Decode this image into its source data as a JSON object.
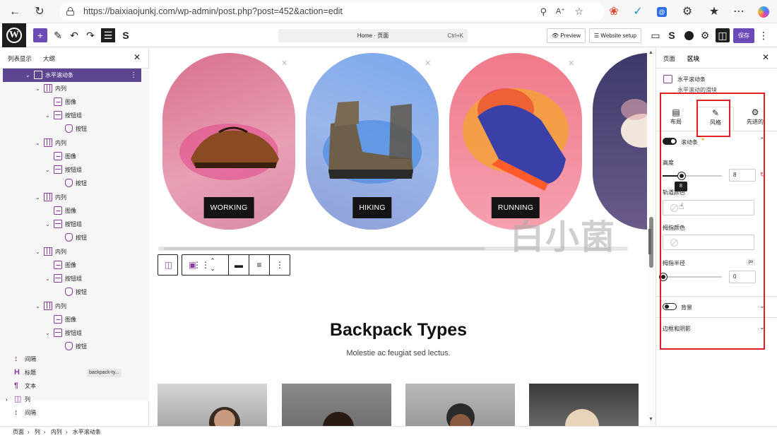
{
  "browser": {
    "url": "https://baixiaojunkj.com/wp-admin/post.php?post=452&action=edit"
  },
  "editor": {
    "document_title": "Home · 页面",
    "shortcut": "Ctrl+K",
    "preview_label": "Preview",
    "website_setup_label": "Website setup",
    "save_label": "保存"
  },
  "left_panel": {
    "tab_list": "列表显示",
    "tab_outline": "大纲",
    "tree": {
      "slider": "水平滚动条",
      "column": "内列",
      "image": "图像",
      "button_group": "按钮组",
      "button": "按钮"
    },
    "blocks": [
      {
        "label": "间隔"
      },
      {
        "label": "标题",
        "tag": "backpack-ty..."
      },
      {
        "label": "文本"
      },
      {
        "label": "列"
      },
      {
        "label": "间隔"
      }
    ]
  },
  "breadcrumb": [
    "页面",
    "列",
    "内列",
    "水平滚动条"
  ],
  "canvas": {
    "slides": [
      "WORKING",
      "HIKING",
      "RUNNING"
    ],
    "section_title": "Backpack Types",
    "section_subtitle": "Molestie ac feugiat sed lectus."
  },
  "right_panel": {
    "tab_page": "页面",
    "tab_block": "区块",
    "block_name": "水平滚动条",
    "block_desc": "水平滚动的滑块",
    "style_tabs": [
      "布局",
      "风格",
      "先进的"
    ],
    "scrollbar_label": "滚动条",
    "height_label": "高度",
    "height_value": "8",
    "height_tooltip": "8",
    "track_color_label": "轨道颜色",
    "thumb_color_label": "拇指颜色",
    "thumb_radius_label": "拇指半径",
    "thumb_radius_value": "0",
    "unit": "px",
    "background_label": "背景",
    "border_shadow_label": "边框和阴影",
    "scrollbar_enabled": true,
    "background_enabled": false,
    "accent": "#6c4bb8",
    "highlight": "#e02020"
  },
  "watermark": "白小菌"
}
